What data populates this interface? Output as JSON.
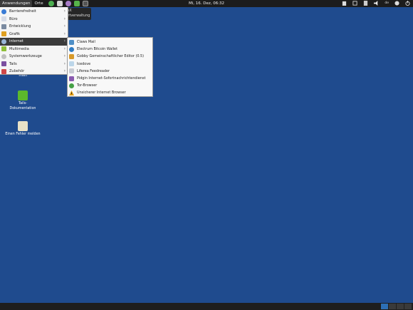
{
  "top_panel": {
    "applications_label": "Anwendungen",
    "places_label": "Orte",
    "clock": "Mi, 16. Dez, 06:32",
    "tray_label": "de"
  },
  "tooltip": {
    "line1": "KeePassX",
    "line2": "Passwortverwaltung"
  },
  "app_menu": {
    "items": [
      {
        "label": "Barrierefreiheit"
      },
      {
        "label": "Büro"
      },
      {
        "label": "Entwicklung"
      },
      {
        "label": "Grafik"
      },
      {
        "label": "Internet"
      },
      {
        "label": "Multimedia"
      },
      {
        "label": "Systemwerkzeuge"
      },
      {
        "label": "Tails"
      },
      {
        "label": "Zubehör"
      }
    ]
  },
  "internet_menu": {
    "items": [
      {
        "label": "Claws Mail"
      },
      {
        "label": "Electrum Bitcoin Wallet"
      },
      {
        "label": "Gobby Gemeinschaftlicher Editor (0.5)"
      },
      {
        "label": "Icedove"
      },
      {
        "label": "Liferea Feedreader"
      },
      {
        "label": "Pidgin Internet-Sofortnachrichtendienst"
      },
      {
        "label": "Tor-Browser"
      },
      {
        "label": "Unsicherer Internet Browser"
      }
    ]
  },
  "desktop": {
    "trash_label": "Trash",
    "tails_doc_label": [
      "Tails-",
      "Dokumentation"
    ],
    "report_error_label": "Einen Fehler melden"
  },
  "colors": {
    "desktop_bg": "#1f4b8e",
    "panel_bg": "#1c1c1c",
    "menu_highlight": "#3b3b3b"
  }
}
